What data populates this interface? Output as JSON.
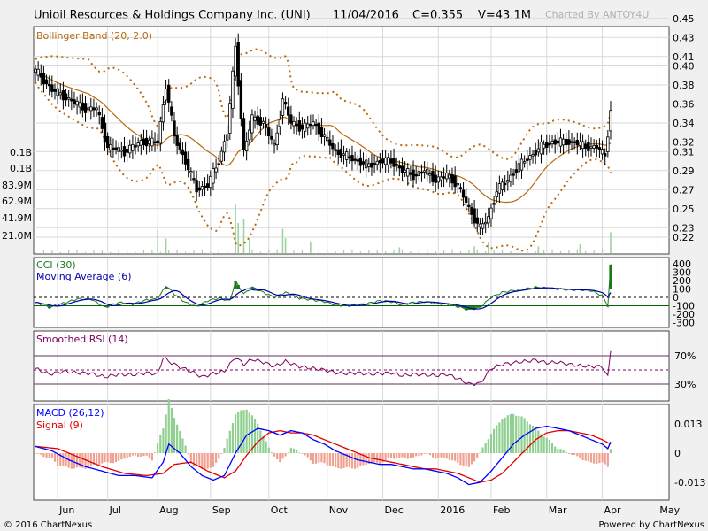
{
  "header": {
    "title": "Unioil Resources & Holdings Company Inc. (UNI)",
    "date": "11/04/2016",
    "close": "C=0.355",
    "volume": "V=43.1M",
    "credit": "Charted By ANTOY4U"
  },
  "footer": {
    "copyright": "© 2016 ChartNexus",
    "powered": "Powered by ChartNexus"
  },
  "colors": {
    "background": "#f0f0f0",
    "panel": "#ffffff",
    "grid": "#d8d8d8",
    "candle": "#000000",
    "bollinger": "#b8690f",
    "volume": "#9fd39f",
    "cci": "#1a7a1a",
    "cci_ma": "#0000aa",
    "rsi": "#800060",
    "macd": "#0000ff",
    "signal": "#e00000",
    "hist_pos": "#8fcf8f",
    "hist_neg": "#f0a090"
  },
  "chart_data": [
    {
      "type": "candlestick",
      "name": "price",
      "legend": "Bollinger Band (20, 2.0)",
      "y_ticks": [
        "0.45",
        "0.43",
        "0.41",
        "0.40",
        "0.38",
        "0.36",
        "0.34",
        "0.32",
        "0.31",
        "0.29",
        "0.27",
        "0.25",
        "0.23",
        "0.22"
      ],
      "y_tick_values": [
        0.45,
        0.43,
        0.41,
        0.4,
        0.38,
        0.36,
        0.34,
        0.32,
        0.31,
        0.29,
        0.27,
        0.25,
        0.23,
        0.22
      ],
      "volume_ticks": [
        "0.1B",
        "0.1B",
        "83.9M",
        "62.9M",
        "41.9M",
        "21.0M"
      ],
      "x_labels": [
        "Jun",
        "Jul",
        "Aug",
        "Sep",
        "Oct",
        "Nov",
        "Dec",
        "2016",
        "Feb",
        "Mar",
        "Apr",
        "May"
      ],
      "x_label_index": [
        8,
        26,
        44,
        63,
        84,
        105,
        125,
        145,
        164,
        184,
        204,
        224
      ],
      "last_close": 0.355,
      "last_volume_millions": 43.1,
      "close_anchors": [
        [
          0,
          0.395
        ],
        [
          6,
          0.375
        ],
        [
          12,
          0.365
        ],
        [
          18,
          0.355
        ],
        [
          22,
          0.355
        ],
        [
          26,
          0.315
        ],
        [
          32,
          0.31
        ],
        [
          38,
          0.32
        ],
        [
          44,
          0.32
        ],
        [
          47,
          0.38
        ],
        [
          50,
          0.325
        ],
        [
          54,
          0.3
        ],
        [
          58,
          0.27
        ],
        [
          62,
          0.275
        ],
        [
          66,
          0.3
        ],
        [
          69,
          0.33
        ],
        [
          72,
          0.42
        ],
        [
          75,
          0.31
        ],
        [
          78,
          0.345
        ],
        [
          82,
          0.34
        ],
        [
          86,
          0.315
        ],
        [
          89,
          0.365
        ],
        [
          92,
          0.34
        ],
        [
          96,
          0.335
        ],
        [
          100,
          0.34
        ],
        [
          104,
          0.325
        ],
        [
          108,
          0.31
        ],
        [
          112,
          0.305
        ],
        [
          116,
          0.3
        ],
        [
          120,
          0.295
        ],
        [
          124,
          0.3
        ],
        [
          128,
          0.3
        ],
        [
          132,
          0.29
        ],
        [
          136,
          0.285
        ],
        [
          140,
          0.29
        ],
        [
          144,
          0.28
        ],
        [
          148,
          0.285
        ],
        [
          152,
          0.275
        ],
        [
          156,
          0.25
        ],
        [
          160,
          0.23
        ],
        [
          163,
          0.24
        ],
        [
          166,
          0.27
        ],
        [
          170,
          0.28
        ],
        [
          174,
          0.295
        ],
        [
          178,
          0.305
        ],
        [
          182,
          0.315
        ],
        [
          186,
          0.32
        ],
        [
          190,
          0.32
        ],
        [
          194,
          0.32
        ],
        [
          198,
          0.315
        ],
        [
          202,
          0.315
        ],
        [
          205,
          0.305
        ],
        [
          207,
          0.355
        ]
      ],
      "volume_millions": [
        [
          44,
          48
        ],
        [
          47,
          30
        ],
        [
          72,
          100
        ],
        [
          73,
          62
        ],
        [
          75,
          70
        ],
        [
          77,
          28
        ],
        [
          89,
          50
        ],
        [
          90,
          31
        ],
        [
          99,
          24
        ],
        [
          131,
          12
        ],
        [
          158,
          14
        ],
        [
          163,
          22
        ],
        [
          181,
          14
        ],
        [
          196,
          18
        ],
        [
          207,
          43.1
        ]
      ]
    },
    {
      "type": "line",
      "name": "cci",
      "legend": [
        "CCI (30)",
        "Moving Average (6)"
      ],
      "y_ticks": [
        "400",
        "300",
        "200",
        "100",
        "0",
        "-100",
        "-200",
        "-300"
      ],
      "y_tick_values": [
        400,
        300,
        200,
        100,
        0,
        -100,
        -200,
        -300
      ],
      "reference_lines": [
        100,
        0,
        -100
      ],
      "anchors": [
        [
          0,
          -60
        ],
        [
          5,
          -120
        ],
        [
          10,
          -70
        ],
        [
          15,
          -20
        ],
        [
          20,
          -20
        ],
        [
          25,
          -120
        ],
        [
          30,
          -60
        ],
        [
          35,
          -80
        ],
        [
          40,
          -30
        ],
        [
          44,
          -20
        ],
        [
          47,
          140
        ],
        [
          50,
          40
        ],
        [
          54,
          -60
        ],
        [
          58,
          -110
        ],
        [
          62,
          -40
        ],
        [
          66,
          -10
        ],
        [
          70,
          -40
        ],
        [
          72,
          190
        ],
        [
          75,
          40
        ],
        [
          78,
          120
        ],
        [
          82,
          60
        ],
        [
          86,
          0
        ],
        [
          90,
          60
        ],
        [
          95,
          -10
        ],
        [
          100,
          -30
        ],
        [
          104,
          -50
        ],
        [
          108,
          -90
        ],
        [
          112,
          -100
        ],
        [
          116,
          -90
        ],
        [
          120,
          -70
        ],
        [
          124,
          -40
        ],
        [
          128,
          -50
        ],
        [
          132,
          -90
        ],
        [
          136,
          -60
        ],
        [
          140,
          -50
        ],
        [
          144,
          -70
        ],
        [
          148,
          -80
        ],
        [
          152,
          -110
        ],
        [
          156,
          -150
        ],
        [
          160,
          -120
        ],
        [
          164,
          0
        ],
        [
          168,
          60
        ],
        [
          172,
          80
        ],
        [
          176,
          100
        ],
        [
          180,
          120
        ],
        [
          184,
          110
        ],
        [
          188,
          100
        ],
        [
          192,
          90
        ],
        [
          196,
          90
        ],
        [
          200,
          80
        ],
        [
          204,
          20
        ],
        [
          206,
          -100
        ],
        [
          207,
          380
        ]
      ]
    },
    {
      "type": "line",
      "name": "rsi",
      "legend": "Smoothed RSI (14)",
      "y_ticks": [
        "70%",
        "30%"
      ],
      "y_tick_values": [
        70,
        30
      ],
      "reference_lines": [
        70,
        50,
        30
      ],
      "anchors": [
        [
          0,
          52
        ],
        [
          5,
          44
        ],
        [
          10,
          48
        ],
        [
          15,
          46
        ],
        [
          20,
          45
        ],
        [
          25,
          40
        ],
        [
          30,
          44
        ],
        [
          35,
          43
        ],
        [
          40,
          46
        ],
        [
          44,
          44
        ],
        [
          46,
          68
        ],
        [
          48,
          62
        ],
        [
          52,
          54
        ],
        [
          56,
          48
        ],
        [
          60,
          40
        ],
        [
          64,
          45
        ],
        [
          68,
          48
        ],
        [
          72,
          68
        ],
        [
          75,
          58
        ],
        [
          78,
          65
        ],
        [
          82,
          61
        ],
        [
          86,
          55
        ],
        [
          90,
          62
        ],
        [
          95,
          55
        ],
        [
          100,
          52
        ],
        [
          104,
          50
        ],
        [
          108,
          46
        ],
        [
          112,
          45
        ],
        [
          116,
          46
        ],
        [
          120,
          44
        ],
        [
          124,
          45
        ],
        [
          128,
          46
        ],
        [
          132,
          42
        ],
        [
          136,
          44
        ],
        [
          140,
          43
        ],
        [
          144,
          42
        ],
        [
          148,
          44
        ],
        [
          152,
          38
        ],
        [
          156,
          30
        ],
        [
          160,
          31
        ],
        [
          164,
          52
        ],
        [
          168,
          58
        ],
        [
          172,
          60
        ],
        [
          176,
          62
        ],
        [
          180,
          64
        ],
        [
          184,
          60
        ],
        [
          188,
          61
        ],
        [
          192,
          58
        ],
        [
          196,
          56
        ],
        [
          200,
          55
        ],
        [
          204,
          55
        ],
        [
          206,
          40
        ],
        [
          207,
          78
        ]
      ]
    },
    {
      "type": "line",
      "name": "macd",
      "legend": [
        "MACD (26,12)",
        "Signal (9)"
      ],
      "y_ticks": [
        "0.013",
        "0",
        "-0.013"
      ],
      "y_tick_values": [
        0.013,
        0,
        -0.013
      ],
      "macd_anchors": [
        [
          0,
          0.003
        ],
        [
          6,
          0.001
        ],
        [
          12,
          -0.003
        ],
        [
          18,
          -0.006
        ],
        [
          24,
          -0.008
        ],
        [
          30,
          -0.01
        ],
        [
          36,
          -0.01
        ],
        [
          42,
          -0.011
        ],
        [
          46,
          -0.004
        ],
        [
          48,
          0.004
        ],
        [
          52,
          0.0
        ],
        [
          56,
          -0.006
        ],
        [
          60,
          -0.01
        ],
        [
          64,
          -0.012
        ],
        [
          68,
          -0.01
        ],
        [
          72,
          0.0
        ],
        [
          76,
          0.008
        ],
        [
          80,
          0.011
        ],
        [
          84,
          0.01
        ],
        [
          88,
          0.008
        ],
        [
          92,
          0.01
        ],
        [
          96,
          0.009
        ],
        [
          100,
          0.006
        ],
        [
          104,
          0.004
        ],
        [
          108,
          0.001
        ],
        [
          112,
          -0.001
        ],
        [
          116,
          -0.003
        ],
        [
          120,
          -0.004
        ],
        [
          124,
          -0.005
        ],
        [
          128,
          -0.005
        ],
        [
          132,
          -0.006
        ],
        [
          136,
          -0.007
        ],
        [
          140,
          -0.007
        ],
        [
          144,
          -0.008
        ],
        [
          148,
          -0.009
        ],
        [
          152,
          -0.011
        ],
        [
          156,
          -0.014
        ],
        [
          160,
          -0.013
        ],
        [
          164,
          -0.008
        ],
        [
          168,
          -0.002
        ],
        [
          172,
          0.004
        ],
        [
          176,
          0.008
        ],
        [
          180,
          0.011
        ],
        [
          184,
          0.012
        ],
        [
          188,
          0.011
        ],
        [
          192,
          0.01
        ],
        [
          196,
          0.008
        ],
        [
          200,
          0.006
        ],
        [
          204,
          0.004
        ],
        [
          206,
          0.002
        ],
        [
          207,
          0.005
        ]
      ],
      "signal_anchors": [
        [
          0,
          0.003
        ],
        [
          8,
          0.002
        ],
        [
          16,
          -0.002
        ],
        [
          24,
          -0.006
        ],
        [
          32,
          -0.009
        ],
        [
          40,
          -0.01
        ],
        [
          46,
          -0.009
        ],
        [
          50,
          -0.005
        ],
        [
          56,
          -0.004
        ],
        [
          62,
          -0.008
        ],
        [
          68,
          -0.011
        ],
        [
          72,
          -0.008
        ],
        [
          76,
          -0.001
        ],
        [
          80,
          0.005
        ],
        [
          84,
          0.009
        ],
        [
          88,
          0.01
        ],
        [
          92,
          0.009
        ],
        [
          96,
          0.009
        ],
        [
          100,
          0.008
        ],
        [
          104,
          0.006
        ],
        [
          108,
          0.004
        ],
        [
          112,
          0.002
        ],
        [
          116,
          0.0
        ],
        [
          120,
          -0.002
        ],
        [
          124,
          -0.003
        ],
        [
          128,
          -0.004
        ],
        [
          132,
          -0.005
        ],
        [
          136,
          -0.006
        ],
        [
          140,
          -0.007
        ],
        [
          144,
          -0.007
        ],
        [
          148,
          -0.008
        ],
        [
          152,
          -0.009
        ],
        [
          156,
          -0.011
        ],
        [
          160,
          -0.013
        ],
        [
          164,
          -0.012
        ],
        [
          168,
          -0.009
        ],
        [
          172,
          -0.004
        ],
        [
          176,
          0.001
        ],
        [
          180,
          0.006
        ],
        [
          184,
          0.009
        ],
        [
          188,
          0.01
        ],
        [
          192,
          0.01
        ],
        [
          196,
          0.009
        ],
        [
          200,
          0.008
        ],
        [
          204,
          0.006
        ],
        [
          207,
          0.004
        ]
      ]
    }
  ]
}
